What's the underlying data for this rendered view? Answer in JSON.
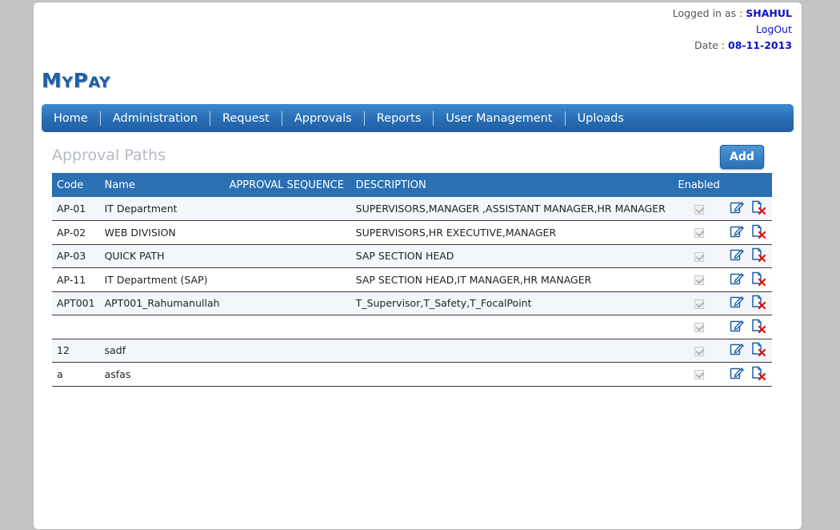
{
  "header": {
    "logged_in_label": "Logged in as :",
    "username": "SHAHUL",
    "logout_label": "LogOut",
    "date_label": "Date :",
    "date_value": "08-11-2013"
  },
  "logo": {
    "first_letter_1": "M",
    "rest_1": "Y",
    "first_letter_2": "P",
    "rest_2": "AY"
  },
  "nav": {
    "items": [
      "Home",
      "Administration",
      "Request",
      "Approvals",
      "Reports",
      "User Management",
      "Uploads"
    ]
  },
  "page": {
    "title": "Approval Paths",
    "add_label": "Add"
  },
  "table": {
    "headers": {
      "code": "Code",
      "name": "Name",
      "sequence": "APPROVAL SEQUENCE",
      "description": "DESCRIPTION",
      "enabled": "Enabled"
    },
    "rows": [
      {
        "code": "AP-01",
        "name": "IT Department",
        "sequence": "",
        "description": "SUPERVISORS,MANAGER ,ASSISTANT MANAGER,HR MANAGER",
        "enabled": true
      },
      {
        "code": "AP-02",
        "name": "WEB DIVISION",
        "sequence": "",
        "description": "SUPERVISORS,HR EXECUTIVE,MANAGER",
        "enabled": true
      },
      {
        "code": "AP-03",
        "name": "QUICK PATH",
        "sequence": "",
        "description": "SAP SECTION HEAD",
        "enabled": true
      },
      {
        "code": "AP-11",
        "name": "IT Department (SAP)",
        "sequence": "",
        "description": "SAP SECTION HEAD,IT MANAGER,HR MANAGER",
        "enabled": true
      },
      {
        "code": "APT001",
        "name": "APT001_Rahumanullah",
        "sequence": "",
        "description": "T_Supervisor,T_Safety,T_FocalPoint",
        "enabled": true
      },
      {
        "code": "",
        "name": "",
        "sequence": "",
        "description": "",
        "enabled": true
      },
      {
        "code": "12",
        "name": "sadf",
        "sequence": "",
        "description": "",
        "enabled": true
      },
      {
        "code": "a",
        "name": "asfas",
        "sequence": "",
        "description": "",
        "enabled": true
      }
    ]
  },
  "icons": {
    "edit": "edit-icon",
    "delete": "delete-icon"
  },
  "colors": {
    "accent": "#2a70b3",
    "link": "#0a10c8",
    "nav_gradient_top": "#3d8ad0",
    "nav_gradient_bottom": "#1f5fa3"
  }
}
